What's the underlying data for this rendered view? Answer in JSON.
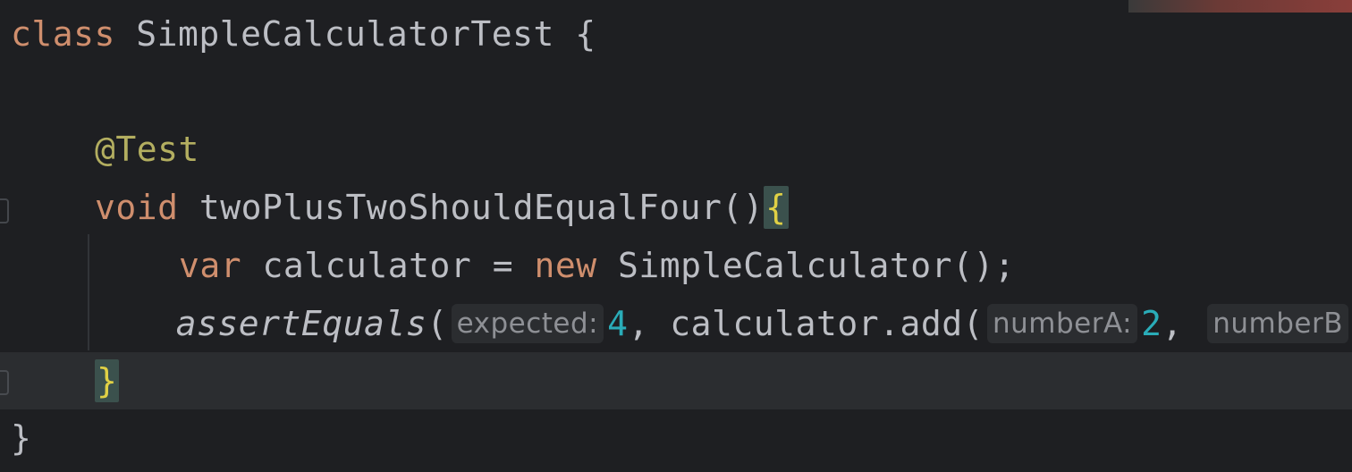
{
  "editor": {
    "line1": {
      "keyword": "class",
      "name": "SimpleCalculatorTest",
      "brace": "{"
    },
    "line3": {
      "annotation": "@Test"
    },
    "line4": {
      "keyword": "void",
      "method": "twoPlusTwoShouldEqualFour",
      "parens": "()",
      "brace": "{"
    },
    "line5": {
      "keyword": "var",
      "varname": "calculator",
      "eq": "=",
      "new": "new",
      "ctor": "SimpleCalculator",
      "tail": "();"
    },
    "line6": {
      "call": "assertEquals",
      "open": "(",
      "hint_expected": "expected:",
      "val_expected": "4",
      "comma1": ",",
      "call2": "calculator.add(",
      "hint_a": "numberA:",
      "val_a": "2",
      "comma2": ",",
      "hint_b": "numberB"
    },
    "line7": {
      "brace": "}"
    },
    "line8": {
      "brace": "}"
    }
  },
  "colors": {
    "background": "#1e1f22",
    "keyword": "#cf8e6d",
    "annotation": "#b3ae60",
    "number": "#2aacb8",
    "text": "#bcbec4",
    "current_line": "#2b2d30"
  }
}
